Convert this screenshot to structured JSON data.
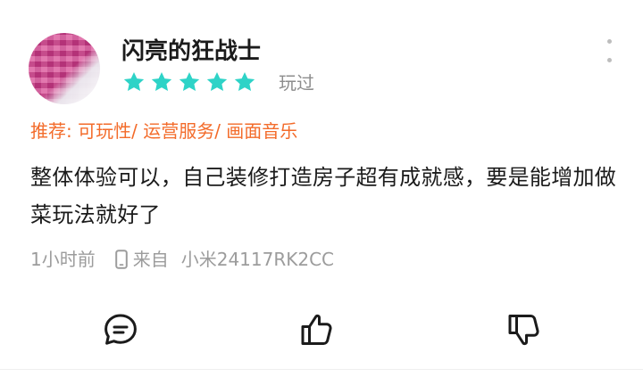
{
  "review": {
    "username": "闪亮的狂战士",
    "rating": 5,
    "status": "玩过",
    "tags_label": "推荐: 可玩性/ 运营服务/ 画面音乐",
    "content": "整体体验可以，自己装修打造房子超有成就感，要是能增加做菜玩法就好了",
    "time": "1小时前",
    "device_prefix": "来自",
    "device_model": "小米24117RK2CC"
  },
  "colors": {
    "star": "#2ed3c7",
    "tag": "#f36b2a",
    "meta": "#9c9c9c",
    "text": "#1b1b1b"
  },
  "icons": {
    "comment": "comment-icon",
    "like": "thumbs-up-icon",
    "dislike": "thumbs-down-icon",
    "more": "more-vertical-icon",
    "device": "phone-icon"
  }
}
